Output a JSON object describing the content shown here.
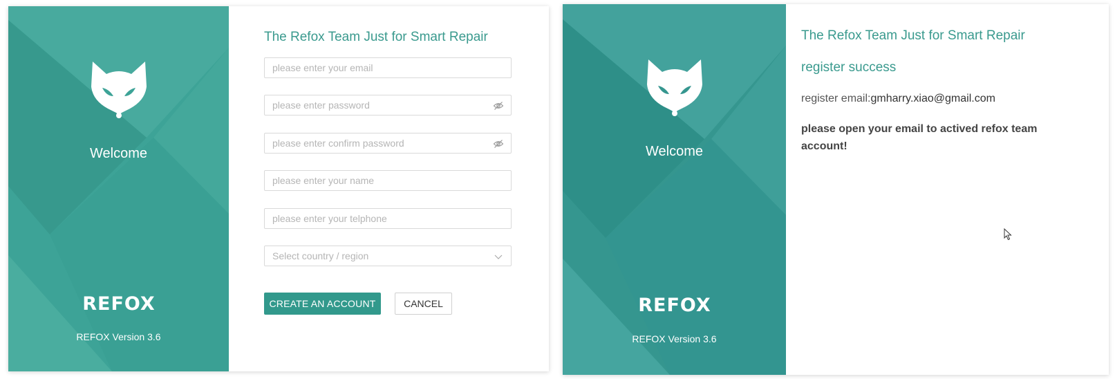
{
  "colors": {
    "brand_teal": "#3da397",
    "brand_teal_dark": "#35968f",
    "title_teal": "#3a9a8e",
    "button_teal": "#32998c"
  },
  "brand": {
    "welcome": "Welcome",
    "wordmark": "REFOX",
    "version": "REFOX Version 3.6",
    "logo_icon": "fox-head-icon"
  },
  "register_form": {
    "title": "The Refox Team Just for Smart Repair",
    "email_placeholder": "please enter your email",
    "password_placeholder": "please enter password",
    "confirm_password_placeholder": "please enter confirm password",
    "name_placeholder": "please enter your name",
    "telephone_placeholder": "please enter your telphone",
    "country_placeholder": "Select country / region",
    "password_toggle_icon": "eye-slash-icon",
    "country_dropdown_icon": "chevron-down-icon",
    "create_button": "CREATE AN ACCOUNT",
    "cancel_button": "CANCEL"
  },
  "success_panel": {
    "title": "The Refox Team Just for Smart Repair",
    "heading": "register success",
    "email_label": "register email:",
    "email_value": "gmharry.xiao@gmail.com",
    "notice": "please open your email to actived refox team account!"
  }
}
